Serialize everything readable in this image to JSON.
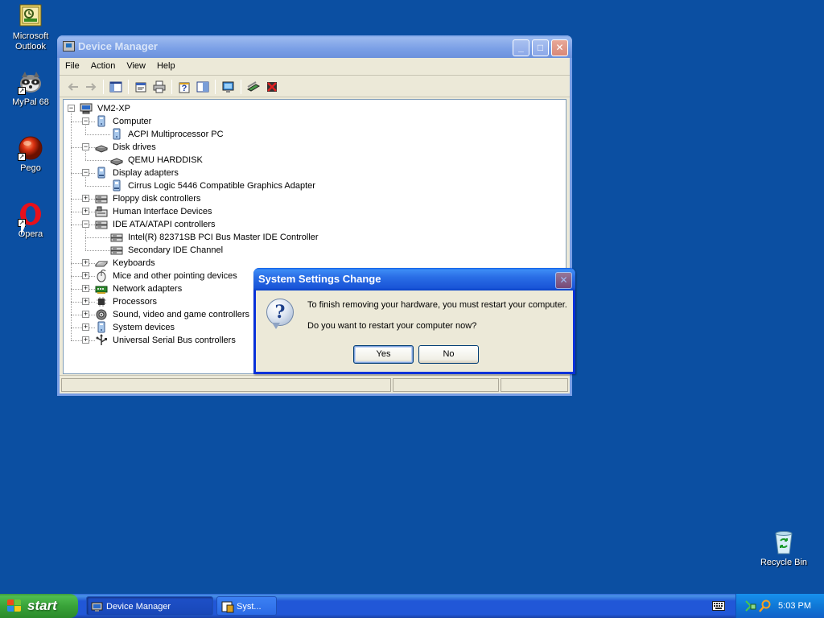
{
  "desktop": {
    "icons": [
      {
        "name": "outlook",
        "label_line1": "Microsoft",
        "label_line2": "Outlook",
        "icon": "outlook-icon"
      },
      {
        "name": "mypal",
        "label_line1": "MyPal 68",
        "label_line2": "",
        "icon": "mypal-raccoon-icon"
      },
      {
        "name": "pego",
        "label_line1": "Pego",
        "label_line2": "",
        "icon": "pego-icon"
      },
      {
        "name": "opera",
        "label_line1": "Opera",
        "label_line2": "",
        "icon": "opera-icon"
      },
      {
        "name": "recycle-bin",
        "label_line1": "Recycle Bin",
        "label_line2": "",
        "icon": "recycle-bin-icon"
      }
    ]
  },
  "device_manager": {
    "title": "Device Manager",
    "menu": [
      "File",
      "Action",
      "View",
      "Help"
    ],
    "tree": [
      {
        "label": "VM2-XP",
        "level": 0,
        "expander": "-",
        "icon": "computer-icon"
      },
      {
        "label": "Computer",
        "level": 1,
        "expander": "-",
        "icon": "computer-category-icon"
      },
      {
        "label": "ACPI Multiprocessor PC",
        "level": 2,
        "expander": "",
        "icon": "computer-category-icon"
      },
      {
        "label": "Disk drives",
        "level": 1,
        "expander": "-",
        "icon": "disk-drive-icon"
      },
      {
        "label": "QEMU HARDDISK",
        "level": 2,
        "expander": "",
        "icon": "disk-drive-icon"
      },
      {
        "label": "Display adapters",
        "level": 1,
        "expander": "-",
        "icon": "display-adapter-icon"
      },
      {
        "label": "Cirrus Logic 5446 Compatible Graphics Adapter",
        "level": 2,
        "expander": "",
        "icon": "display-adapter-icon"
      },
      {
        "label": "Floppy disk controllers",
        "level": 1,
        "expander": "+",
        "icon": "controller-icon"
      },
      {
        "label": "Human Interface Devices",
        "level": 1,
        "expander": "+",
        "icon": "hid-icon"
      },
      {
        "label": "IDE ATA/ATAPI controllers",
        "level": 1,
        "expander": "-",
        "icon": "controller-icon"
      },
      {
        "label": "Intel(R) 82371SB PCI Bus Master IDE Controller",
        "level": 2,
        "expander": "",
        "icon": "controller-icon"
      },
      {
        "label": "Secondary IDE Channel",
        "level": 2,
        "expander": "",
        "icon": "controller-icon"
      },
      {
        "label": "Keyboards",
        "level": 1,
        "expander": "+",
        "icon": "keyboard-icon"
      },
      {
        "label": "Mice and other pointing devices",
        "level": 1,
        "expander": "+",
        "icon": "mouse-icon"
      },
      {
        "label": "Network adapters",
        "level": 1,
        "expander": "+",
        "icon": "network-adapter-icon"
      },
      {
        "label": "Processors",
        "level": 1,
        "expander": "+",
        "icon": "processor-icon"
      },
      {
        "label": "Sound, video and game controllers",
        "level": 1,
        "expander": "+",
        "icon": "sound-icon"
      },
      {
        "label": "System devices",
        "level": 1,
        "expander": "+",
        "icon": "computer-category-icon"
      },
      {
        "label": "Universal Serial Bus controllers",
        "level": 1,
        "expander": "+",
        "icon": "usb-icon"
      }
    ]
  },
  "dialog": {
    "title": "System Settings Change",
    "message1": "To finish removing your hardware, you must restart your computer.",
    "message2": "Do you want to restart your computer now?",
    "yes_label": "Yes",
    "no_label": "No",
    "icon": "question-icon"
  },
  "taskbar": {
    "start_label": "start",
    "items": [
      {
        "label": "Device Manager",
        "icon": "device-manager-icon"
      },
      {
        "label": "Syst...",
        "icon": "system-settings-icon"
      }
    ],
    "clock": "5:03 PM"
  }
}
